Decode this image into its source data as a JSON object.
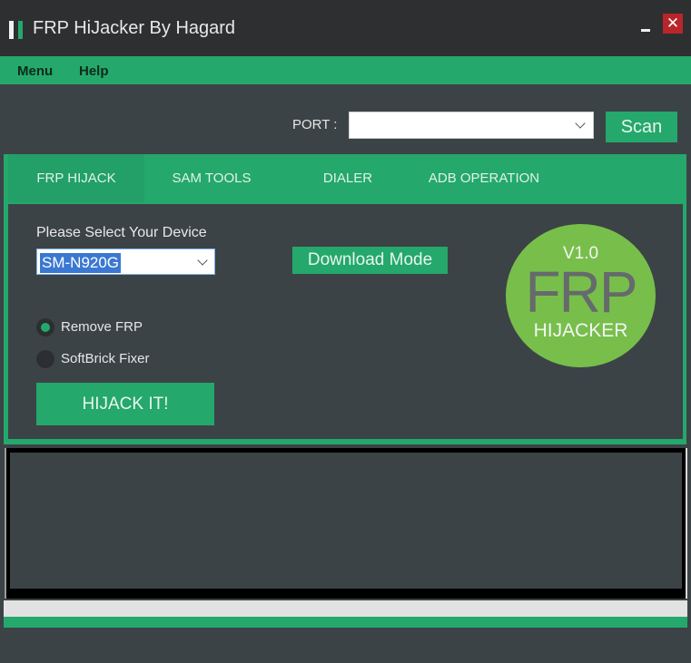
{
  "window": {
    "title": "FRP HiJacker By Hagard",
    "icon": "app-icon",
    "minimize_label": "",
    "close_label": "✕"
  },
  "menubar": {
    "items": [
      {
        "label": "Menu"
      },
      {
        "label": "Help"
      }
    ]
  },
  "port": {
    "label": "PORT :",
    "value": "",
    "scan_label": "Scan"
  },
  "tabs": [
    {
      "label": "FRP HIJACK",
      "active": true
    },
    {
      "label": "SAM TOOLS",
      "active": false
    },
    {
      "label": "DIALER",
      "active": false
    },
    {
      "label": "ADB OPERATION",
      "active": false
    }
  ],
  "frp_panel": {
    "device_label": "Please Select Your Device",
    "device_value": "SM-N920G",
    "download_mode_label": "Download Mode",
    "options": [
      {
        "label": "Remove FRP",
        "selected": true
      },
      {
        "label": "SoftBrick Fixer",
        "selected": false
      }
    ],
    "hijack_label": "HIJACK IT!",
    "logo": {
      "version": "V1.0",
      "main": "FRP",
      "sub": "HIJACKER"
    }
  },
  "log": {
    "text": ""
  },
  "progress": {
    "value_percent": 0
  },
  "colors": {
    "accent": "#24a86c",
    "background": "#3c4346",
    "titlebar": "#2d2f31",
    "close": "#b8262a",
    "logo": "#77bf4a"
  }
}
